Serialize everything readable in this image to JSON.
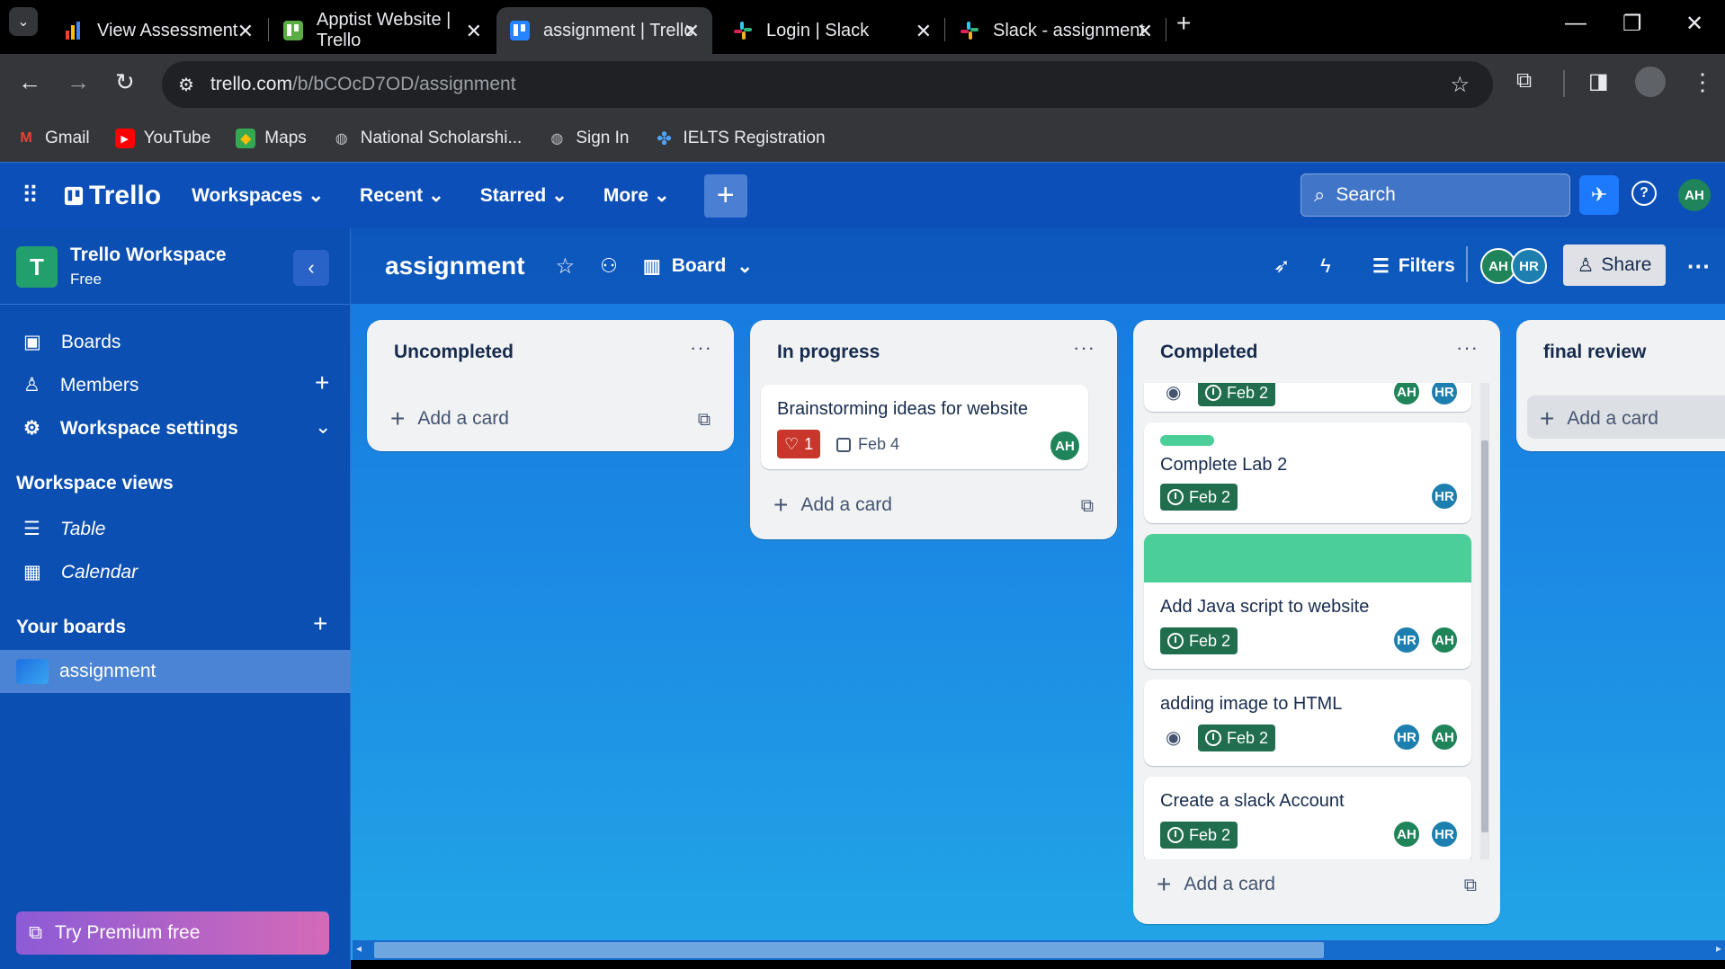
{
  "browser": {
    "tabs": [
      {
        "title": "View Assessment",
        "icon": "bar-chart-icon"
      },
      {
        "title": "Apptist Website | Trello",
        "icon": "trello-icon"
      },
      {
        "title": "assignment | Trello",
        "icon": "trello-icon",
        "active": true
      },
      {
        "title": "Login | Slack",
        "icon": "slack-icon"
      },
      {
        "title": "Slack - assignment - Assi",
        "icon": "slack-icon"
      }
    ],
    "url_domain": "trello.com",
    "url_path": "/b/bCOcD7OD/assignment",
    "bookmarks": [
      {
        "label": "Gmail",
        "icon": "gmail-icon"
      },
      {
        "label": "YouTube",
        "icon": "youtube-icon"
      },
      {
        "label": "Maps",
        "icon": "maps-icon"
      },
      {
        "label": "National Scholarshi...",
        "icon": "globe-icon"
      },
      {
        "label": "Sign In",
        "icon": "globe-icon"
      },
      {
        "label": "IELTS Registration",
        "icon": "ielts-icon"
      }
    ]
  },
  "header": {
    "logo": "Trello",
    "menus": [
      "Workspaces",
      "Recent",
      "Starred",
      "More"
    ],
    "search_placeholder": "Search",
    "user_initials": "AH"
  },
  "sidebar": {
    "workspace_initial": "T",
    "workspace_name": "Trello Workspace",
    "workspace_plan": "Free",
    "items": [
      "Boards",
      "Members",
      "Workspace settings"
    ],
    "views_heading": "Workspace views",
    "views": [
      "Table",
      "Calendar"
    ],
    "boards_heading": "Your boards",
    "boards": [
      "assignment"
    ],
    "premium": "Try Premium free"
  },
  "board": {
    "name": "assignment",
    "view": "Board",
    "filters": "Filters",
    "share": "Share",
    "members": [
      "AH",
      "HR"
    ]
  },
  "lists": [
    {
      "title": "Uncompleted",
      "add": "Add a card"
    },
    {
      "title": "In progress",
      "add": "Add a card",
      "cards": [
        {
          "title": "Brainstorming ideas for website",
          "votes": "1",
          "date": "Feb 4",
          "members": [
            "AH"
          ]
        }
      ]
    },
    {
      "title": "Completed",
      "add": "Add a card",
      "cards": [
        {
          "title": "",
          "date": "Feb 2",
          "members": [
            "AH",
            "HR"
          ]
        },
        {
          "title": "Complete Lab 2",
          "date": "Feb 2",
          "members": [
            "HR"
          ]
        },
        {
          "title": "Add Java script to website",
          "date": "Feb 2",
          "members": [
            "HR",
            "AH"
          ]
        },
        {
          "title": "adding image to HTML",
          "date": "Feb 2",
          "members": [
            "HR",
            "AH"
          ]
        },
        {
          "title": "Create a slack Account",
          "date": "Feb 2",
          "members": [
            "AH",
            "HR"
          ]
        }
      ]
    },
    {
      "title": "final review",
      "add": "Add a card"
    }
  ],
  "colors": {
    "header": "#0c4fb8",
    "sidebar": "#0b4fb2",
    "due_green": "#216e4e",
    "label_green": "#4bce97",
    "vote_red": "#c9372c"
  }
}
